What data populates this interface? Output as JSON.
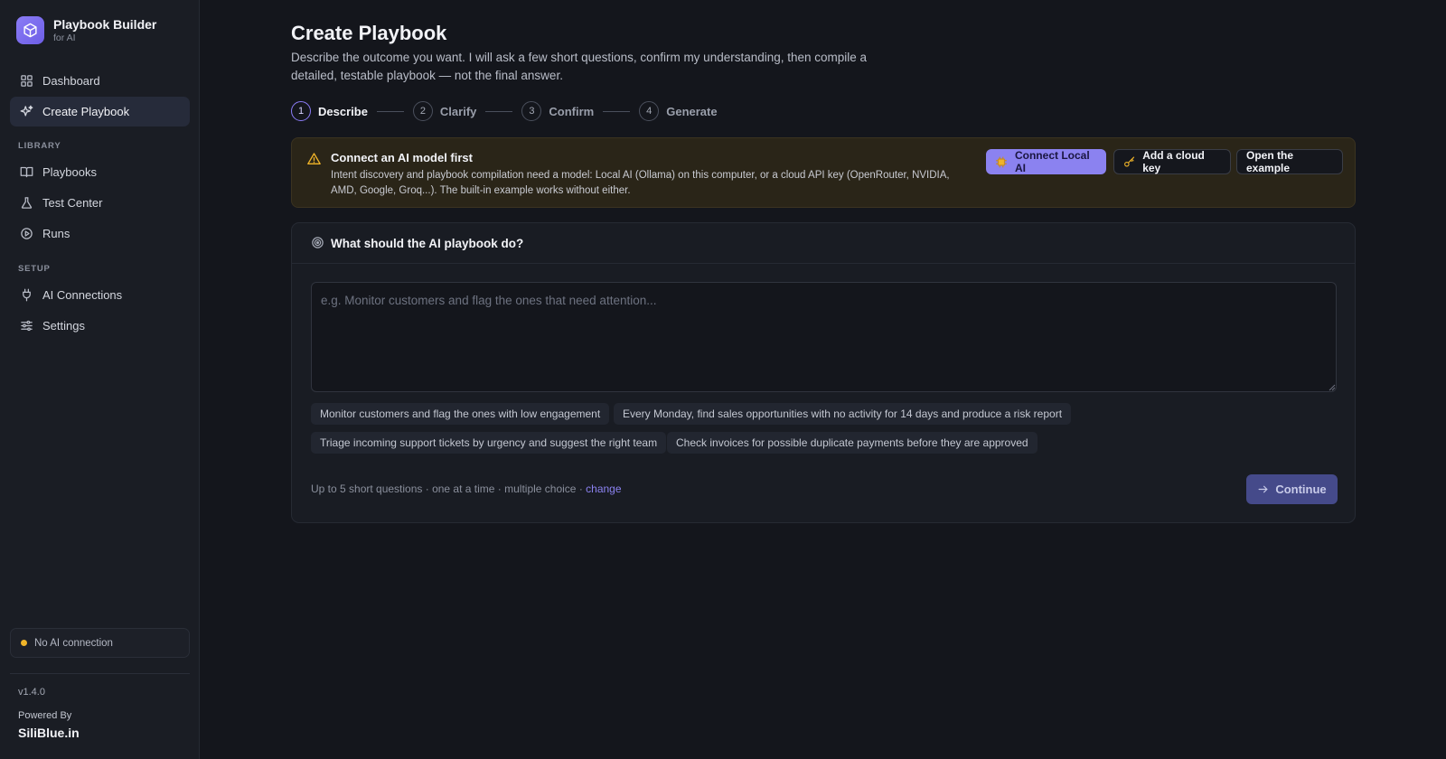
{
  "app": {
    "title": "Playbook Builder",
    "subtitle": "for AI"
  },
  "sidebar": {
    "main_items": [
      {
        "label": "Dashboard",
        "icon": "grid-icon"
      },
      {
        "label": "Create Playbook",
        "icon": "sparkle-icon",
        "active": true
      }
    ],
    "library_heading": "LIBRARY",
    "library_items": [
      {
        "label": "Playbooks",
        "icon": "book-icon"
      },
      {
        "label": "Test Center",
        "icon": "flask-icon"
      },
      {
        "label": "Runs",
        "icon": "play-circle-icon"
      }
    ],
    "setup_heading": "SETUP",
    "setup_items": [
      {
        "label": "AI Connections",
        "icon": "plug-icon"
      },
      {
        "label": "Settings",
        "icon": "sliders-icon"
      }
    ],
    "status": {
      "text": "No AI connection",
      "color": "#f0b429"
    },
    "version": "v1.4.0",
    "powered_by": "Powered By",
    "powered_brand": "SiliBlue.in"
  },
  "page": {
    "title": "Create Playbook",
    "description": "Describe the outcome you want. I will ask a few short questions, confirm my understanding, then compile a detailed, testable playbook — not the final answer."
  },
  "stepper": {
    "steps": [
      {
        "num": "1",
        "label": "Describe",
        "active": true
      },
      {
        "num": "2",
        "label": "Clarify"
      },
      {
        "num": "3",
        "label": "Confirm"
      },
      {
        "num": "4",
        "label": "Generate"
      }
    ]
  },
  "alert": {
    "title": "Connect an AI model first",
    "text": "Intent discovery and playbook compilation need a model: Local AI (Ollama) on this computer, or a cloud API key (OpenRouter, NVIDIA, AMD, Google, Groq...). The built-in example works without either.",
    "buttons": {
      "connect_local": "Connect Local AI",
      "add_cloud_key": "Add a cloud key",
      "open_example": "Open the example"
    }
  },
  "prompt_card": {
    "title": "What should the AI playbook do?",
    "placeholder": "e.g. Monitor customers and flag the ones that need attention...",
    "value": "",
    "suggestions": [
      "Monitor customers and flag the ones with low engagement",
      "Every Monday, find sales opportunities with no activity for 14 days and produce a risk report",
      "Triage incoming support tickets by urgency and suggest the right team",
      "Check invoices for possible duplicate payments before they are approved"
    ],
    "hint": "Up to 5 short questions · one at a time · multiple choice · ",
    "hint_link": "change",
    "continue_label": "Continue"
  },
  "colors": {
    "accent": "#8b82f0",
    "warning": "#f0b429",
    "background": "#14161c"
  }
}
